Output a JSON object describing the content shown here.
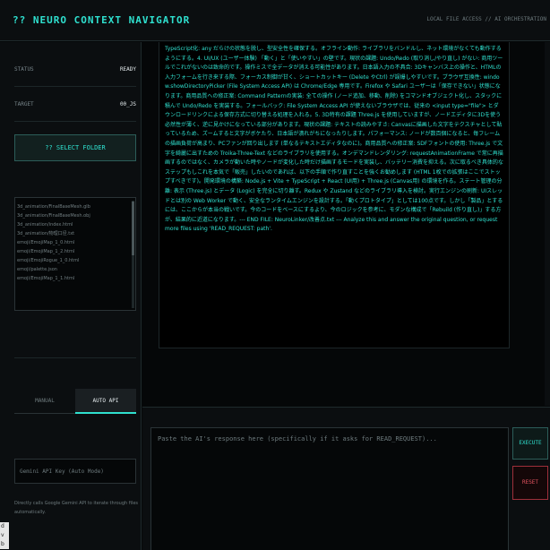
{
  "header": {
    "title": "?? NEURO CONTEXT NAVIGATOR",
    "right_text": "LOCAL FILE ACCESS // AI ORCHESTRATION"
  },
  "sidebar": {
    "status_label": "STATUS",
    "status_value": "READY",
    "target_label": "TARGET",
    "target_value": "00_JS",
    "select_button": "?? SELECT FOLDER",
    "files": [
      "3d_animation/FinalBaseMesh.glb",
      "3d_animation/FinalBaseMesh.obj",
      "3d_animation/index.html",
      "3d_animation/物理口径.txt",
      "emoji/EmojiMap_1_0.html",
      "emoji/EmojiMap_1_2.html",
      "emoji/EmojiRogue_1_0.html",
      "emoji/palette.json",
      "emoji/EmojiMap_1_1.html"
    ],
    "tabs": [
      "MANUAL",
      "AUTO API"
    ],
    "active_tab": "AUTO API",
    "api_key_placeholder": "Gemini API Key (Auto Mode)",
    "api_note": "Directly calls Google Gemini API to iterate through files automatically."
  },
  "main": {
    "context_text": "TypeScript化: any だらけの状態を脱し、型安全性を確保する。オフライン動作: ライブラリをバンドルし、ネット環境がなくても動作するようにする。4. UI/UX (ユーザー体験) 「動く」と「使いやすい」の壁です。現状の課題: Undo/Redo (取り消し/やり直し) がない: 商用ツールでこれがないのは致命的です。操作ミスで全データが消える可能性があります。日本語入力の不具合: 3Dキャンバス上の操作と、HTMLの入力フォームを行き来する際、フォーカス制御が甘く、ショートカットキー (Delete やCtrl) が誤爆しやすいです。ブラウザ互換性: window.showDirectoryPicker (File System Access API) は Chrome/Edge 専用です。Firefox や Safari ユーザーは「保存できない」状態になります。商用品質への修正案: Command Patternの実装: 全ての操作 (ノード追加、移動、削除) をコマンドオブジェクト化し、スタックに積んで Undo/Redo を実装する。フォールバック: File System Access API が使えないブラウザでは、従来の <input type=\"file\"> とダウンロードリンクによる保存方式に切り替える処理を入れる。5. 3D特有の課題 Three.js を使用していますが、ノードエディタに3Dを使う必然性が薄く、逆に見かけになっている部分があります。現状の課題: テキストの読みやすさ: Canvasに描画した文字をテクスチャとして貼っているため、ズームすると文字がボケたり、日本語が潰れがちになったりします。パフォーマンス: ノードが数百個になると、毎フレームの描画負荷が高まり、PCファンが回り出します (単なるテキストエディタなのに)。商用品質への修正案: SDFフォントの使用: Three.js で文字を綺麗に出すための Troika-Three-Text などのライブラリを使用する。オンデマンドレンダリング: requestAnimationFrame で常に再描画するのではなく、カメラが動いた時やノードが変化した時だけ描画するモードを実装し、バッテリー消費を抑える。次に取るべき具体的なステップもしこれを本気で「販売」したいのであれば、以下の手順で作り直すことを強くお勧めします (HTML 1枚での拡張はここでストップすべきです)。開発環境の構築: Node.js + Vite + TypeScript + React (UI用) + Three.js (Canvas用) の環境を作る。ステート管理の分離: 表示 (Three.js) とデータ (Logic) を完全に切り離す。Redux や Zustand などのライブラリ導入を検討。実行エンジンの刷新: UIスレッドとは別の Web Worker で動く、安全なランタイムエンジンを設計する。「動くプロトタイプ」としては100点です。しかし「製品」とするには、ここからが本当の戦いです。今のコードをベースにするより、今のロジックを参考に、モダンな構成で「Rebuild (作り直し)」する方が、結果的に近道になります。--- END FILE: NeuroLinker/改善点.txt --- Analyze this and answer the original question, or request more files using 'READ_REQUEST: path'."
  },
  "bottom": {
    "response_placeholder": "Paste the AI's response here (specifically if it asks for READ_REQUEST)...",
    "execute_button": "EXECUTE",
    "reset_button": "RESET"
  },
  "corner": {
    "chars": [
      "d",
      "v",
      "b"
    ]
  },
  "colors": {
    "accent": "#2fe0cf",
    "danger": "#e0525e",
    "background": "#050708",
    "panel": "#0b0e10"
  }
}
